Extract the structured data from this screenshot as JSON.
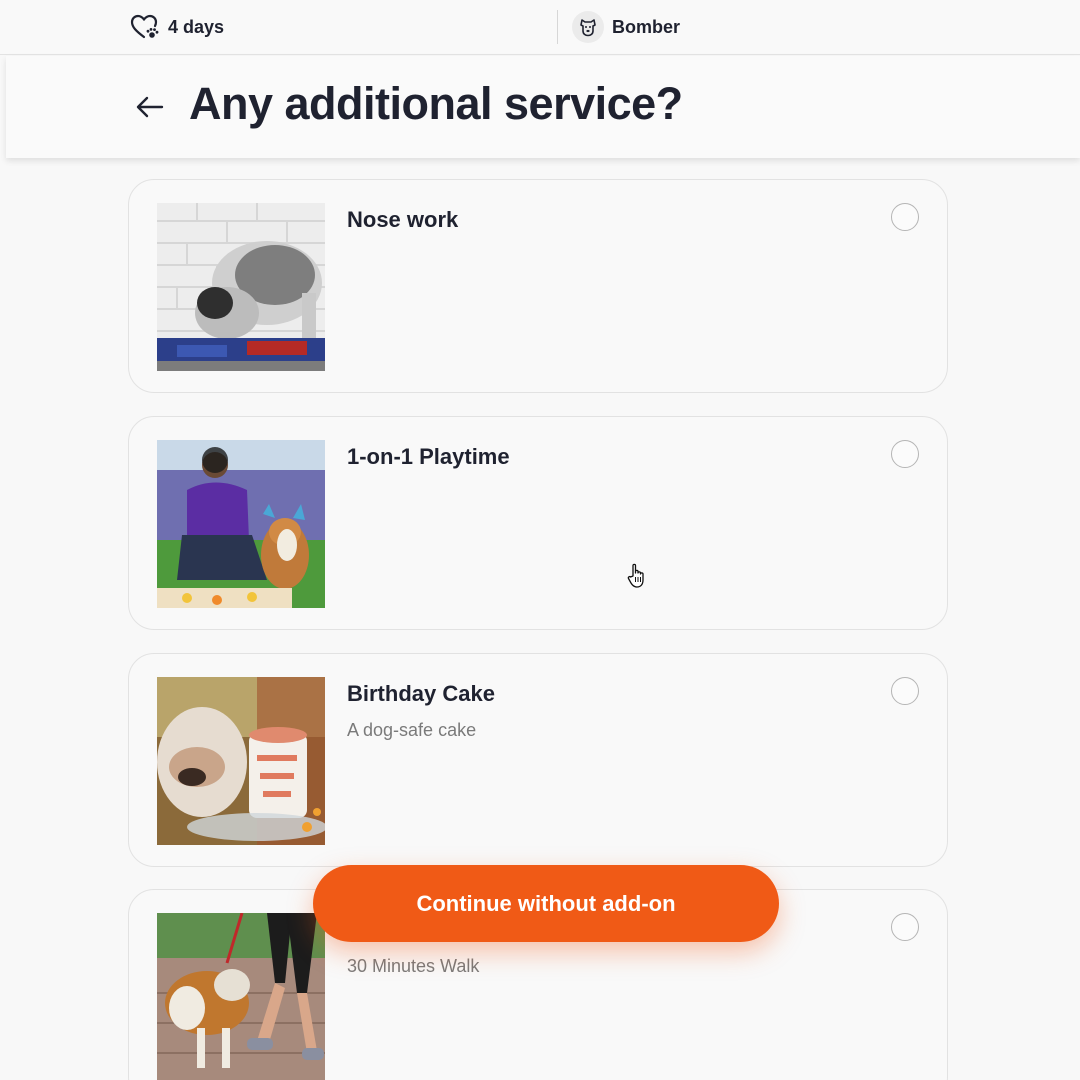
{
  "topbar": {
    "duration_label": "4 days",
    "pet_name": "Bomber"
  },
  "header": {
    "title": "Any additional service?"
  },
  "services": [
    {
      "title": "Nose work",
      "subtitle": "",
      "image": "dog-sniffing-snuffle-mat-photo",
      "selected": false
    },
    {
      "title": "1-on-1 Playtime",
      "subtitle": "",
      "image": "trainer-with-corgi-photo",
      "selected": false
    },
    {
      "title": "Birthday Cake",
      "subtitle": "A dog-safe cake",
      "image": "bulldog-birthday-cake-photo",
      "selected": false
    },
    {
      "title": "",
      "subtitle": "30 Minutes Walk",
      "image": "dog-walking-photo",
      "selected": false
    }
  ],
  "actions": {
    "continue_label": "Continue without add-on"
  },
  "colors": {
    "accent": "#f05a16",
    "text": "#1f2230",
    "muted": "#7a7a7a",
    "background": "#f8f8f8"
  }
}
